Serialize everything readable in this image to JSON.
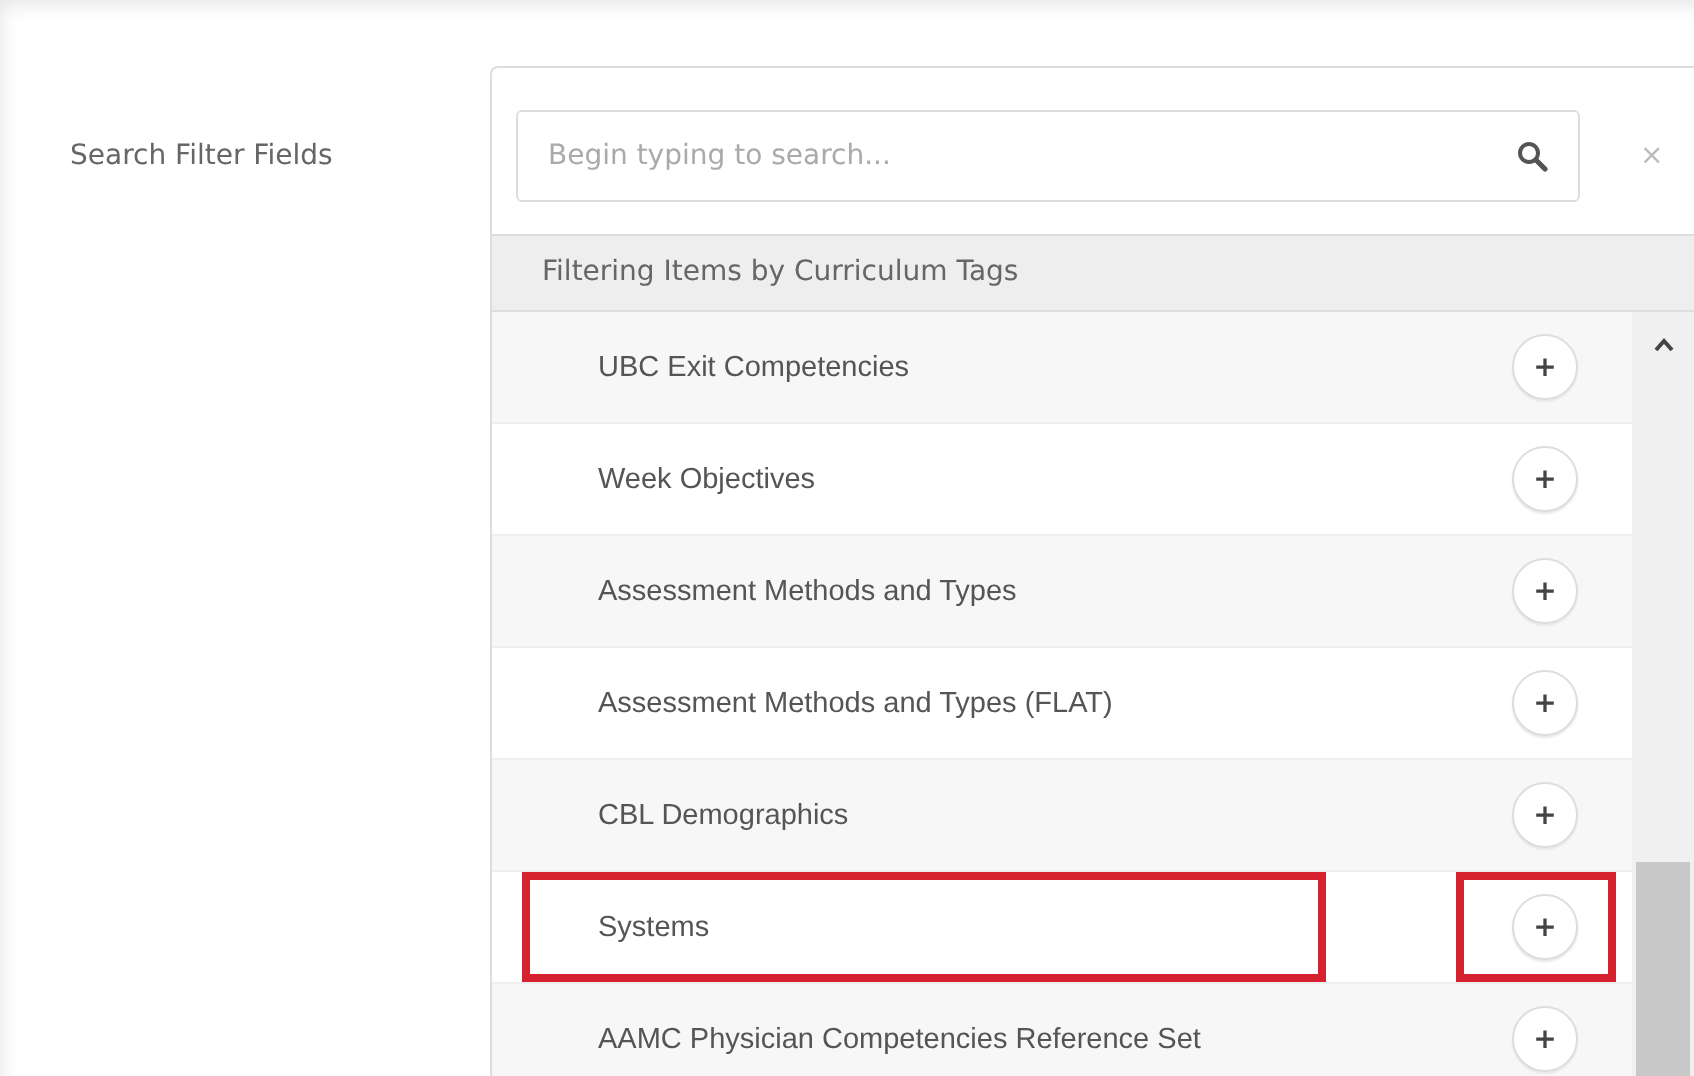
{
  "filter_label": "Search Filter Fields",
  "search": {
    "placeholder": "Begin typing to search..."
  },
  "close_button": "×",
  "group_header": "Filtering Items by Curriculum Tags",
  "items": [
    {
      "label": "UBC Exit Competencies",
      "add_button": "+",
      "marked": false
    },
    {
      "label": "Week Objectives",
      "add_button": "+",
      "marked": false
    },
    {
      "label": "Assessment Methods and Types",
      "add_button": "+",
      "marked": false
    },
    {
      "label": "Assessment Methods and Types (FLAT)",
      "add_button": "+",
      "marked": false
    },
    {
      "label": "CBL Demographics",
      "add_button": "+",
      "marked": false
    },
    {
      "label": "Systems",
      "add_button": "+",
      "marked": true
    },
    {
      "label": "AAMC Physician Competencies Reference Set",
      "add_button": "+",
      "marked": false
    }
  ]
}
